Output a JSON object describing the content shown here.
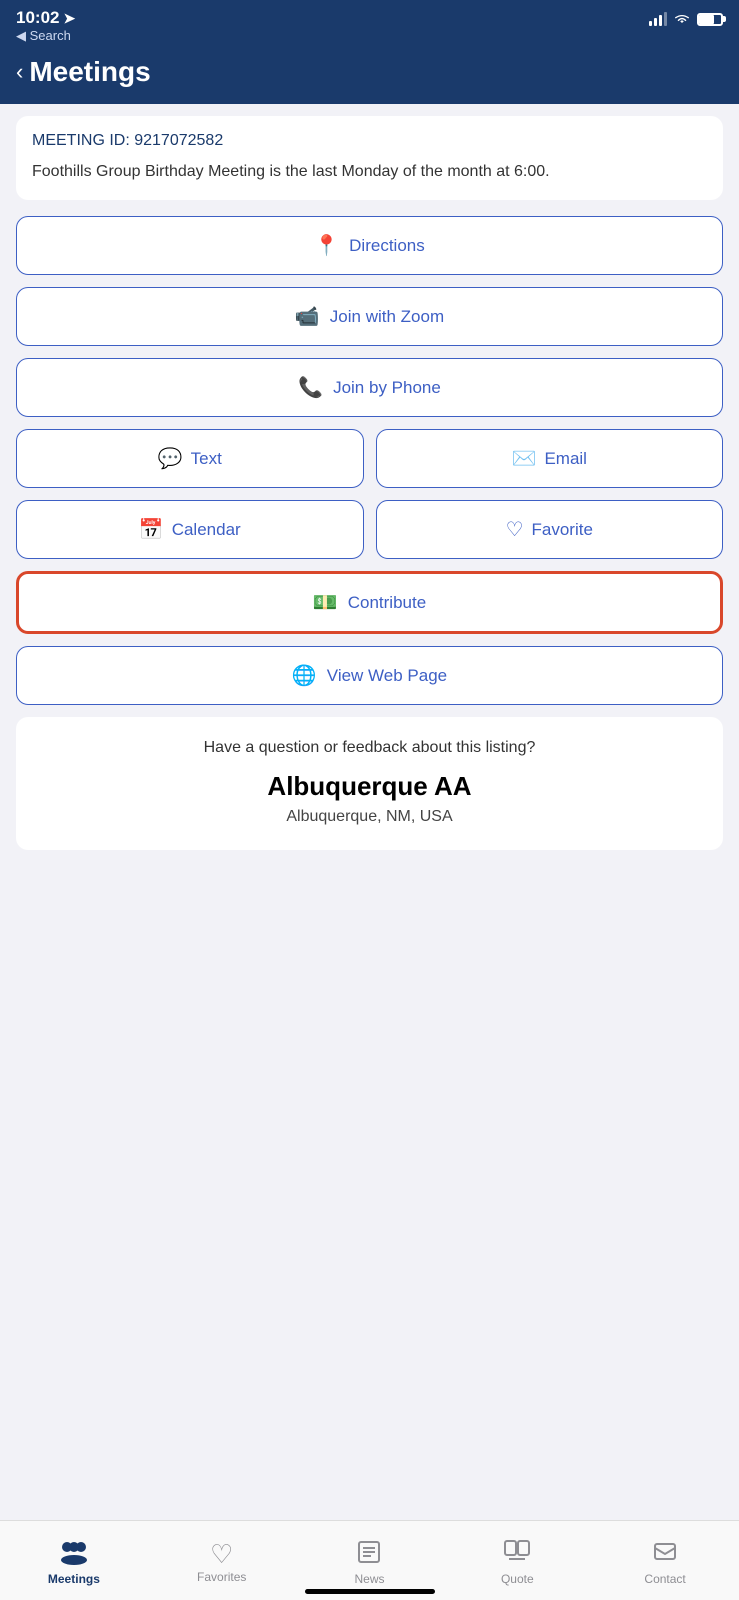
{
  "statusBar": {
    "time": "10:02",
    "locationIcon": "▶",
    "searchBack": "◀ Search"
  },
  "header": {
    "backLabel": "‹",
    "title": "Meetings"
  },
  "meetingCard": {
    "meetingId": "MEETING ID: 9217072582",
    "description": "Foothills Group Birthday Meeting is the last Monday of the month at 6:00."
  },
  "buttons": {
    "directions": "Directions",
    "joinZoom": "Join with Zoom",
    "joinPhone": "Join by Phone",
    "text": "Text",
    "email": "Email",
    "calendar": "Calendar",
    "favorite": "Favorite",
    "contribute": "Contribute",
    "viewWebPage": "View Web Page"
  },
  "feedbackCard": {
    "question": "Have a question or feedback about this listing?",
    "orgName": "Albuquerque AA",
    "location": "Albuquerque, NM, USA"
  },
  "tabBar": {
    "items": [
      {
        "id": "meetings",
        "label": "Meetings",
        "active": true
      },
      {
        "id": "favorites",
        "label": "Favorites",
        "active": false
      },
      {
        "id": "news",
        "label": "News",
        "active": false
      },
      {
        "id": "quote",
        "label": "Quote",
        "active": false
      },
      {
        "id": "contact",
        "label": "Contact",
        "active": false
      }
    ]
  }
}
